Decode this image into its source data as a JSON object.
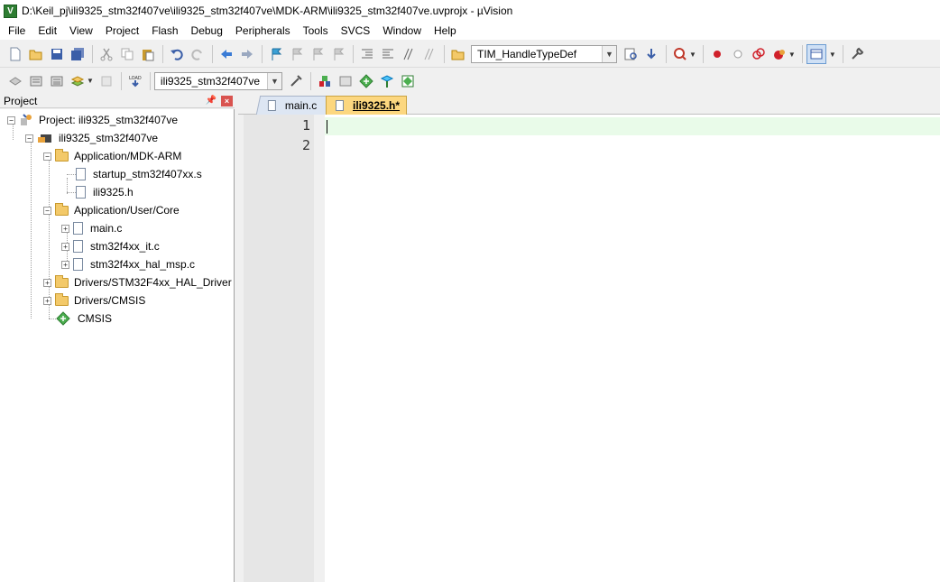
{
  "window": {
    "title": "D:\\Keil_pj\\ili9325_stm32f407ve\\ili9325_stm32f407ve\\MDK-ARM\\ili9325_stm32f407ve.uvprojx - µVision",
    "icon_letter": "V"
  },
  "menu": [
    "File",
    "Edit",
    "View",
    "Project",
    "Flash",
    "Debug",
    "Peripherals",
    "Tools",
    "SVCS",
    "Window",
    "Help"
  ],
  "toolbar1": {
    "find_combo": "TIM_HandleTypeDef"
  },
  "toolbar2": {
    "target_combo": "ili9325_stm32f407ve"
  },
  "project_panel": {
    "title": "Project",
    "tree": {
      "project": "Project: ili9325_stm32f407ve",
      "target": "ili9325_stm32f407ve",
      "groups": [
        {
          "name": "Application/MDK-ARM",
          "files": [
            "startup_stm32f407xx.s",
            "ili9325.h"
          ]
        },
        {
          "name": "Application/User/Core",
          "files": [
            "main.c",
            "stm32f4xx_it.c",
            "stm32f4xx_hal_msp.c"
          ]
        },
        {
          "name": "Drivers/STM32F4xx_HAL_Driver",
          "files": []
        },
        {
          "name": "Drivers/CMSIS",
          "files": []
        }
      ],
      "cmsis": "CMSIS"
    }
  },
  "editor": {
    "tabs": [
      {
        "label": "main.c",
        "active": false
      },
      {
        "label": "ili9325.h*",
        "active": true
      }
    ],
    "line_numbers": [
      "1",
      "2"
    ]
  },
  "colors": {
    "active_tab": "#fcd77f",
    "current_line": "#e9fbe9",
    "close_button": "#d9534f"
  }
}
